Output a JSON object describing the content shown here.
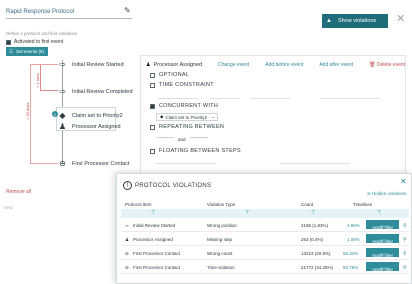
{
  "header": {
    "protocol_name": "Rapid Response Protocol",
    "define_text": "Define a protocol and find violations.",
    "activated_label": "Activated to first event",
    "set_events_label": "Set events (5)",
    "show_violations_label": "Show violations"
  },
  "flow": {
    "nodes": [
      {
        "label": "Initial Review Started",
        "icon": "arrow-icon"
      },
      {
        "label": "Initial Review Completed",
        "icon": "arrow-icon"
      },
      {
        "label": "Claim set to Priority2",
        "icon": "diamond-icon"
      },
      {
        "label": "Processor Assigned",
        "icon": "person-icon"
      },
      {
        "label": "First Processor Contact",
        "icon": "chat-icon"
      }
    ],
    "bracket_1_label": "< 1 hour",
    "bracket_2_label": "< 30 days",
    "badge": "1",
    "remove_all_label": "Remove all",
    "version_label": "©RO"
  },
  "detail": {
    "event_title": "Processor Assigned",
    "change_event": "Change event",
    "add_before": "Add before event",
    "add_after": "Add after event",
    "delete_event": "Delete event",
    "optional_label": "OPTIONAL",
    "time_constraint_label": "TIME CONSTRAINT",
    "concurrent_label": "CONCURRENT WITH",
    "concurrent_value": "Claim set to Priority2",
    "repeating_label": "REPEATING BETWEEN",
    "and_label": "and",
    "floating_label": "FLOATING BETWEEN STEPS"
  },
  "violations": {
    "title": "PROTOCOL VIOLATIONS",
    "hidden_label": "Hidden violations",
    "columns": {
      "item": "Protocol Item",
      "type": "Violation Type",
      "count": "Count",
      "timeline": "Timelines"
    },
    "apply_label": "Apply filter",
    "rows": [
      {
        "item": "Initial Review Started",
        "type": "Wrong position",
        "count": "2165 (1.83%)",
        "pct": "4.96%"
      },
      {
        "item": "Processor Assigned",
        "type": "Missing step",
        "count": "253 (0.4%)",
        "pct": "1.08%"
      },
      {
        "item": "First Processor Contact",
        "type": "Wrong count",
        "count": "13224 (20.8%)",
        "pct": "56.34%"
      },
      {
        "item": "First Processor Contact",
        "type": "Time violation",
        "count": "21772 (34.25%)",
        "pct": "92.76%"
      }
    ]
  },
  "colors": {
    "accent": "#2e8c9b",
    "dark_button": "#1f6d7a",
    "danger": "#c0504d"
  }
}
